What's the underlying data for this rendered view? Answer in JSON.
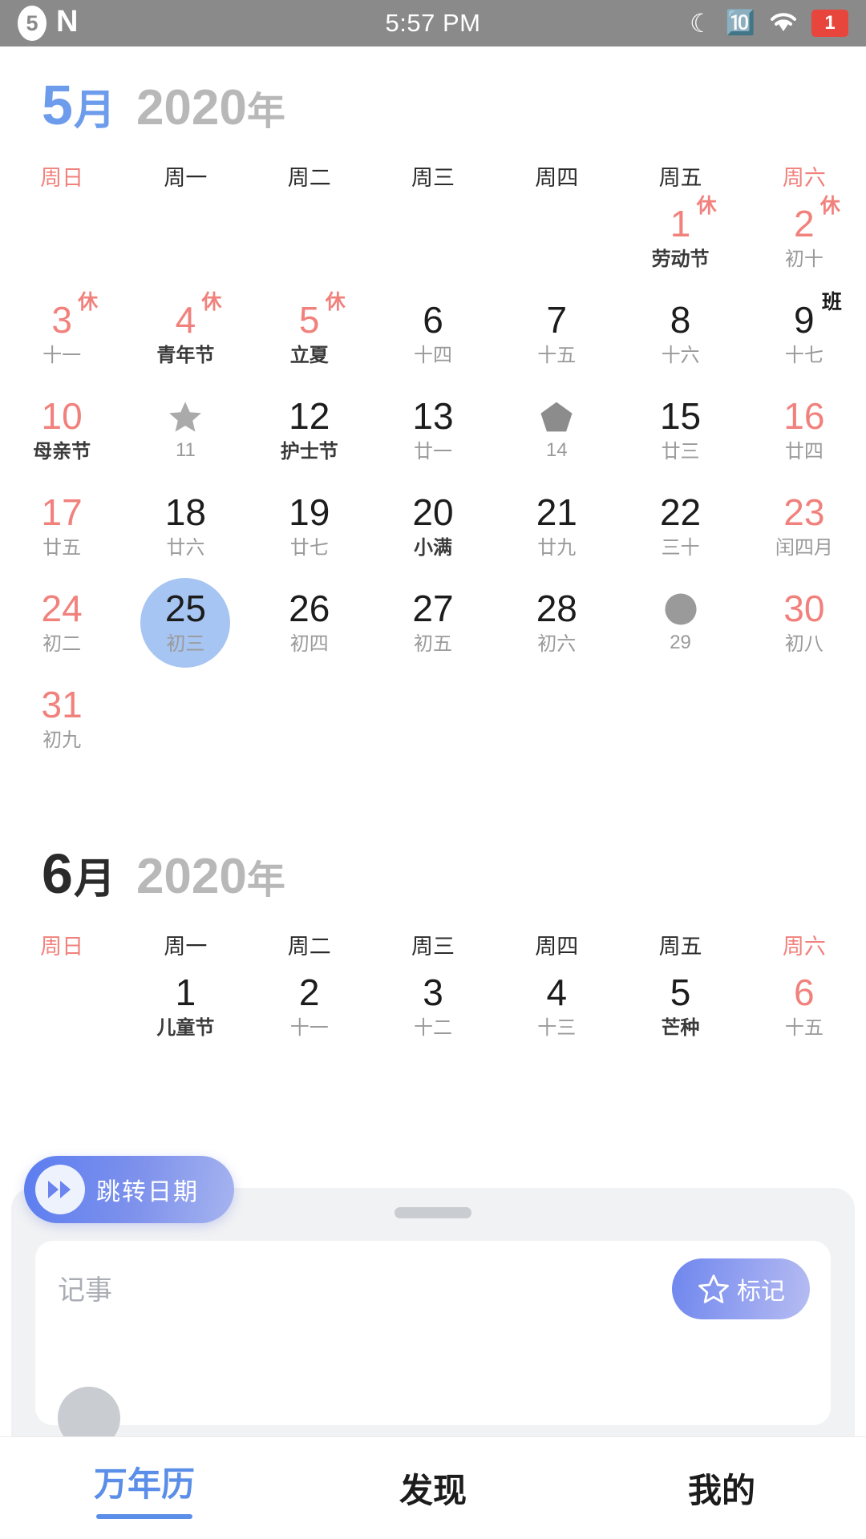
{
  "statusbar": {
    "notif_count": "5",
    "app_logo": "N",
    "time": "5:57 PM",
    "moon_icon": "moon-icon",
    "bluetooth_icon": "bluetooth-icon",
    "wifi_icon": "wifi-icon",
    "battery_label": "1",
    "battery_color": "#e8453c"
  },
  "theme": {
    "accent_blue": "#6e9cec",
    "weekend_red": "#f1817c",
    "selected_bg": "#a6c5f2",
    "lunar_gray": "#9a9a9a"
  },
  "weekdays": [
    {
      "label": "周日",
      "weekend": true
    },
    {
      "label": "周一",
      "weekend": false
    },
    {
      "label": "周二",
      "weekend": false
    },
    {
      "label": "周三",
      "weekend": false
    },
    {
      "label": "周四",
      "weekend": false
    },
    {
      "label": "周五",
      "weekend": false
    },
    {
      "label": "周六",
      "weekend": true
    }
  ],
  "may": {
    "month_num": "5",
    "month_suffix": "月",
    "year": "2020",
    "year_suffix": "年",
    "weeks": [
      [
        {
          "empty": true
        },
        {
          "empty": true
        },
        {
          "empty": true
        },
        {
          "empty": true
        },
        {
          "empty": true
        },
        {
          "day": "1",
          "lunar": "劳动节",
          "red": true,
          "festival": true,
          "badge": "休",
          "badge_type": "rest"
        },
        {
          "day": "2",
          "lunar": "初十",
          "red": true,
          "badge": "休",
          "badge_type": "rest"
        }
      ],
      [
        {
          "day": "3",
          "lunar": "十一",
          "red": true,
          "badge": "休",
          "badge_type": "rest"
        },
        {
          "day": "4",
          "lunar": "青年节",
          "red": true,
          "festival": true,
          "badge": "休",
          "badge_type": "rest"
        },
        {
          "day": "5",
          "lunar": "立夏",
          "red": true,
          "festival": true,
          "badge": "休",
          "badge_type": "rest"
        },
        {
          "day": "6",
          "lunar": "十四"
        },
        {
          "day": "7",
          "lunar": "十五"
        },
        {
          "day": "8",
          "lunar": "十六"
        },
        {
          "day": "9",
          "lunar": "十七",
          "badge": "班",
          "badge_type": "work"
        }
      ],
      [
        {
          "day": "10",
          "lunar": "母亲节",
          "red": true,
          "festival": true
        },
        {
          "shape": "star-icon",
          "lunar": "11"
        },
        {
          "day": "12",
          "lunar": "护士节",
          "festival": true
        },
        {
          "day": "13",
          "lunar": "廿一"
        },
        {
          "shape": "pentagon-icon",
          "lunar": "14"
        },
        {
          "day": "15",
          "lunar": "廿三"
        },
        {
          "day": "16",
          "lunar": "廿四",
          "red": true
        }
      ],
      [
        {
          "day": "17",
          "lunar": "廿五",
          "red": true
        },
        {
          "day": "18",
          "lunar": "廿六"
        },
        {
          "day": "19",
          "lunar": "廿七"
        },
        {
          "day": "20",
          "lunar": "小满",
          "festival": true
        },
        {
          "day": "21",
          "lunar": "廿九"
        },
        {
          "day": "22",
          "lunar": "三十"
        },
        {
          "day": "23",
          "lunar": "闰四月",
          "red": true
        }
      ],
      [
        {
          "day": "24",
          "lunar": "初二",
          "red": true
        },
        {
          "day": "25",
          "lunar": "初三",
          "selected": true
        },
        {
          "day": "26",
          "lunar": "初四"
        },
        {
          "day": "27",
          "lunar": "初五"
        },
        {
          "day": "28",
          "lunar": "初六"
        },
        {
          "shape": "circle-icon",
          "lunar": "29"
        },
        {
          "day": "30",
          "lunar": "初八",
          "red": true
        }
      ],
      [
        {
          "day": "31",
          "lunar": "初九",
          "red": true
        },
        {
          "empty": true
        },
        {
          "empty": true
        },
        {
          "empty": true
        },
        {
          "empty": true
        },
        {
          "empty": true
        },
        {
          "empty": true
        }
      ]
    ]
  },
  "june": {
    "month_num": "6",
    "month_suffix": "月",
    "year": "2020",
    "year_suffix": "年",
    "weeks": [
      [
        {
          "empty": true
        },
        {
          "day": "1",
          "lunar": "儿童节",
          "festival": true
        },
        {
          "day": "2",
          "lunar": "十一"
        },
        {
          "day": "3",
          "lunar": "十二"
        },
        {
          "day": "4",
          "lunar": "十三"
        },
        {
          "day": "5",
          "lunar": "芒种",
          "festival": true
        },
        {
          "day": "6",
          "lunar": "十五",
          "red": true
        }
      ]
    ]
  },
  "jump_button": {
    "label": "跳转日期",
    "icon": "fast-forward-icon"
  },
  "sheet": {
    "note_placeholder": "记事",
    "mark_label": "标记",
    "mark_icon": "star-icon",
    "grabber": "drag-handle"
  },
  "bottomnav": {
    "items": [
      {
        "label": "万年历",
        "active": true
      },
      {
        "label": "发现",
        "active": false
      },
      {
        "label": "我的",
        "active": false
      }
    ]
  }
}
